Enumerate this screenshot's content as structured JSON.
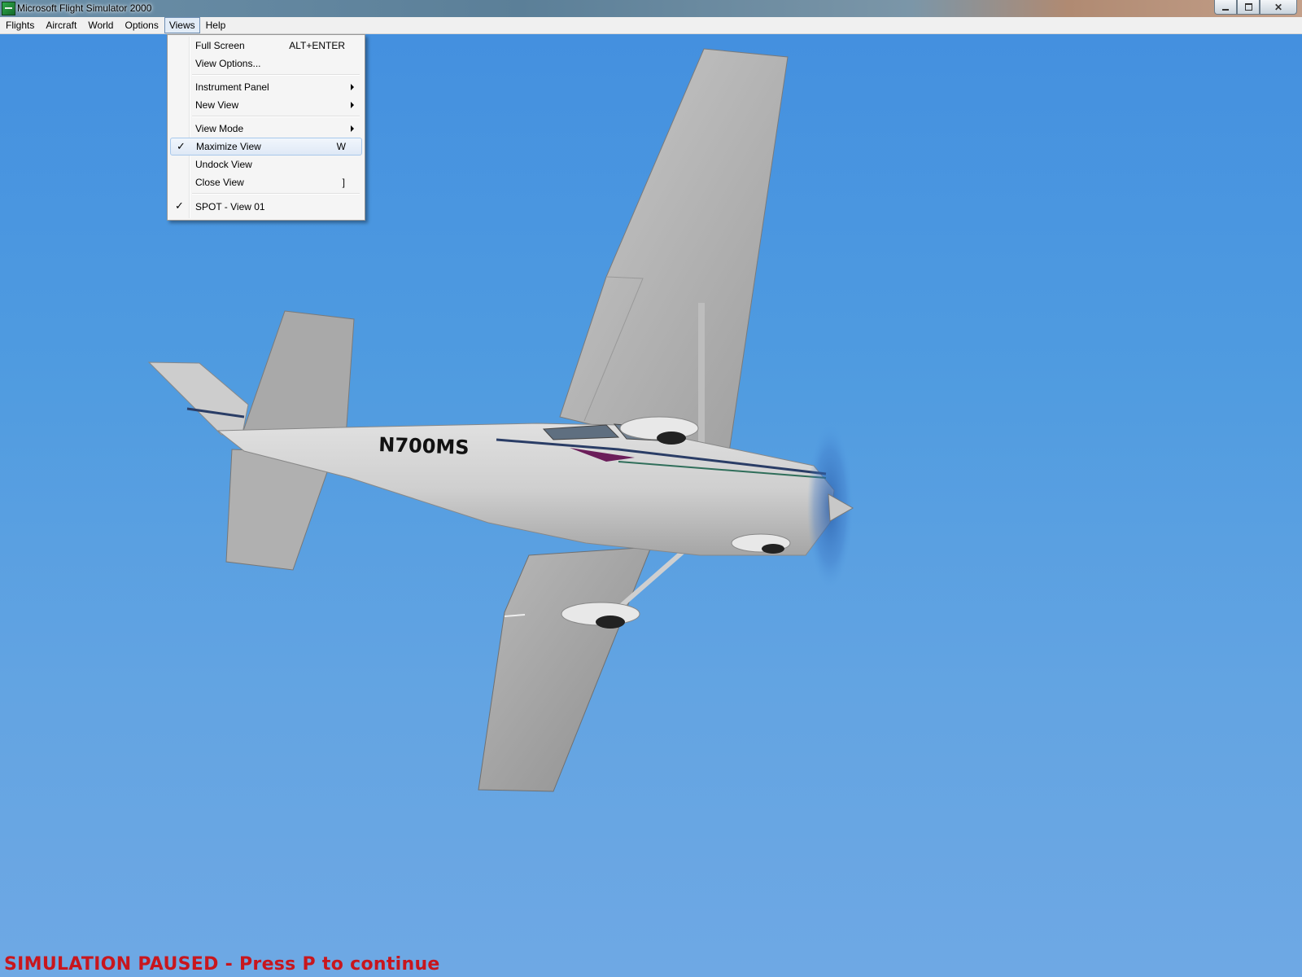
{
  "window": {
    "title": "Microsoft Flight Simulator 2000",
    "app_icon": "fs2000-app-icon",
    "controls": [
      "minimize-icon",
      "restore-icon",
      "close-icon"
    ]
  },
  "menubar": {
    "items": [
      {
        "label": "Flights"
      },
      {
        "label": "Aircraft"
      },
      {
        "label": "World"
      },
      {
        "label": "Options"
      },
      {
        "label": "Views",
        "active": true
      },
      {
        "label": "Help"
      }
    ]
  },
  "views_menu": {
    "items": [
      {
        "label": "Full Screen",
        "shortcut": "ALT+ENTER"
      },
      {
        "label": "View Options..."
      },
      {
        "label": "Instrument Panel",
        "submenu": true
      },
      {
        "label": "New View",
        "submenu": true
      },
      {
        "label": "View Mode",
        "submenu": true
      },
      {
        "label": "Maximize View",
        "shortcut": "W",
        "checked": true,
        "highlighted": true
      },
      {
        "label": "Undock View"
      },
      {
        "label": "Close View",
        "shortcut": "]"
      },
      {
        "label": "SPOT - View 01",
        "checked": true
      }
    ],
    "check_glyph": "✓"
  },
  "scene": {
    "aircraft_registration": "N700MS",
    "sky_color": "#4a94dc"
  },
  "status": {
    "paused_message": "SIMULATION PAUSED - Press P to continue"
  }
}
